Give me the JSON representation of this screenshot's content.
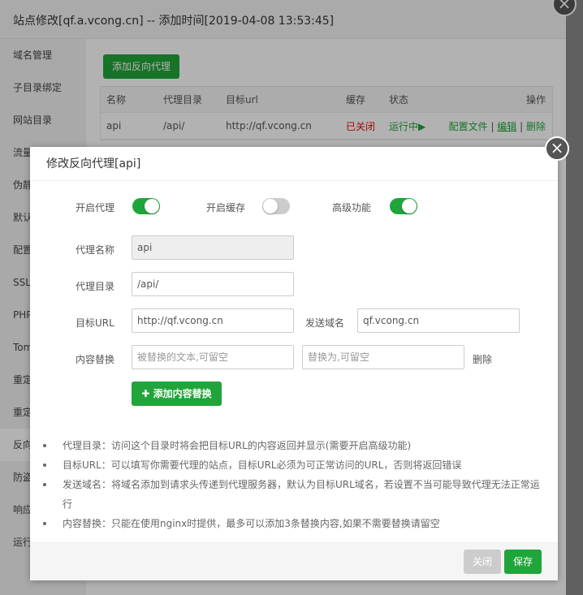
{
  "background": {
    "title": "站点修改[qf.a.vcong.cn] -- 添加时间[2019-04-08 13:53:45]",
    "sidebar": [
      {
        "label": "域名管理"
      },
      {
        "label": "子目录绑定"
      },
      {
        "label": "网站目录"
      },
      {
        "label": "流量"
      },
      {
        "label": "伪静"
      },
      {
        "label": "默认"
      },
      {
        "label": "配置"
      },
      {
        "label": "SSL"
      },
      {
        "label": "PHP"
      },
      {
        "label": "Tom"
      },
      {
        "label": "重定"
      },
      {
        "label": "重定"
      },
      {
        "label": "反向"
      },
      {
        "label": "防盗"
      },
      {
        "label": "响应"
      },
      {
        "label": "运行"
      }
    ],
    "add_proxy_button": "添加反向代理",
    "table": {
      "headers": [
        "名称",
        "代理目录",
        "目标url",
        "缓存",
        "状态",
        "操作"
      ],
      "rows": [
        {
          "name": "api",
          "dir": "/api/",
          "url": "http://qf.vcong.cn",
          "cache": "已关闭",
          "status": "运行中▶",
          "op_config": "配置文件",
          "op_edit": "编辑",
          "op_delete": "删除"
        }
      ]
    }
  },
  "dialog": {
    "title": "修改反向代理[api]",
    "close_icon": "×",
    "toggles": {
      "enable_proxy": {
        "label": "开启代理",
        "on": true
      },
      "enable_cache": {
        "label": "开启缓存",
        "on": false
      },
      "advanced": {
        "label": "高级功能",
        "on": true
      }
    },
    "fields": {
      "proxy_name": {
        "label": "代理名称",
        "value": "api"
      },
      "proxy_dir": {
        "label": "代理目录",
        "value": "/api/"
      },
      "target_url": {
        "label": "目标URL",
        "value": "http://qf.vcong.cn"
      },
      "send_domain": {
        "label": "发送域名",
        "value": "qf.vcong.cn"
      },
      "content_replace": {
        "label": "内容替换",
        "placeholder_from": "被替换的文本,可留空",
        "placeholder_to": "替换为,可留空",
        "delete": "删除"
      }
    },
    "add_replace_button": "添加内容替换",
    "tips": [
      "代理目录：访问这个目录时将会把目标URL的内容返回并显示(需要开启高级功能)",
      "目标URL：可以填写你需要代理的站点，目标URL必须为可正常访问的URL，否则将返回错误",
      "发送域名：将域名添加到请求头传递到代理服务器，默认为目标URL域名，若设置不当可能导致代理无法正常运行",
      "内容替换：只能在使用nginx时提供，最多可以添加3条替换内容,如果不需要替换请留空"
    ],
    "footer": {
      "close": "关闭",
      "save": "保存"
    }
  },
  "colors": {
    "accent": "#20a53a",
    "danger": "#ef0808"
  }
}
